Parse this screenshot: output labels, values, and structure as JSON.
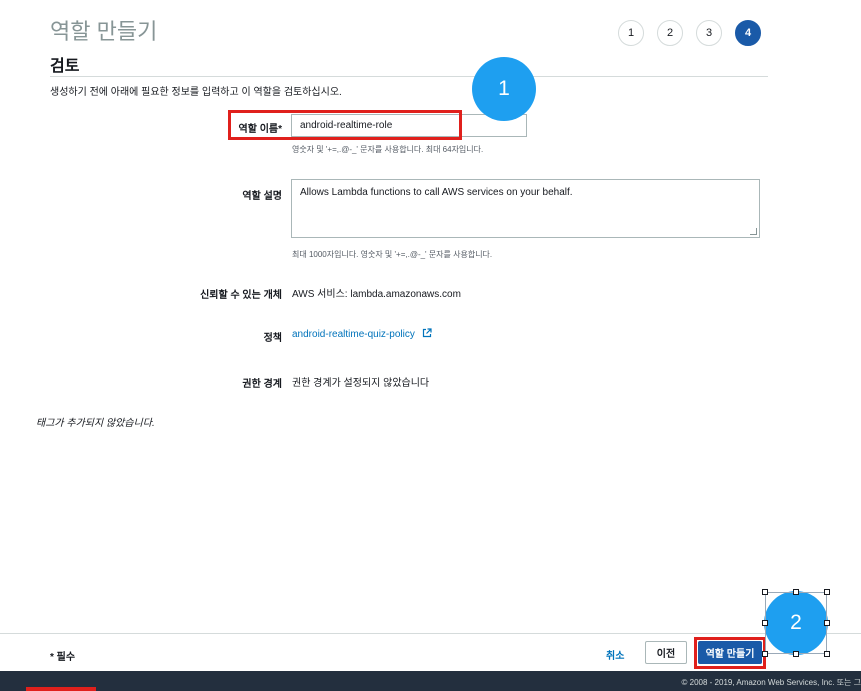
{
  "header": {
    "title": "역할 만들기",
    "steps": [
      "1",
      "2",
      "3",
      "4"
    ],
    "active_step": "4"
  },
  "review": {
    "section_title": "검토",
    "intro": "생성하기 전에 아래에 필요한 정보를 입력하고 이 역할을 검토하십시오.",
    "role_name": {
      "label": "역할 이름*",
      "value": "android-realtime-role",
      "hint": "영숫자 및 '+=,.@-_' 문자를 사용합니다. 최대 64자입니다."
    },
    "role_description": {
      "label": "역할 설명",
      "value": "Allows Lambda functions to call AWS services on your behalf.",
      "hint": "최대 1000자입니다. 영숫자 및 '+=,.@-_' 문자를 사용합니다."
    },
    "trusted_entity": {
      "label": "신뢰할 수 있는 개체",
      "value": "AWS 서비스: lambda.amazonaws.com"
    },
    "policy": {
      "label": "정책",
      "link": "android-realtime-quiz-policy",
      "icon": "external-link-icon"
    },
    "permissions_boundary": {
      "label": "권한 경계",
      "value": "권한 경계가 설정되지 않았습니다"
    },
    "tags_note": "태그가 추가되지 않았습니다."
  },
  "footer": {
    "required_note": "* 필수",
    "cancel_label": "취소",
    "previous_label": "이전",
    "create_label": "역할 만들기"
  },
  "annotations": {
    "callout_1": "1",
    "callout_2": "2",
    "highlight_color": "#e0201c",
    "callout_color": "#1e9ff0"
  },
  "bottom_bar": {
    "copyright": "© 2008 - 2019, Amazon Web Services, Inc. 또는 그"
  },
  "colors": {
    "primary": "#1a5aa8",
    "link": "#0073bb",
    "footer_dark": "#232f3e"
  }
}
